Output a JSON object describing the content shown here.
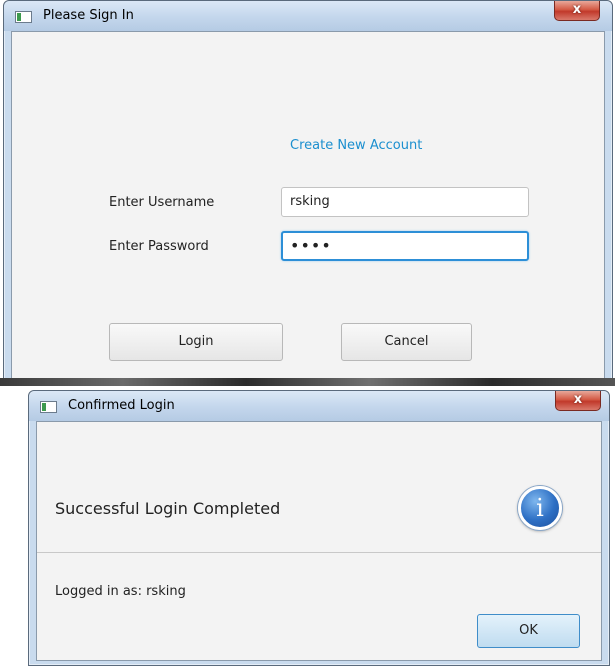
{
  "signin": {
    "title": "Please Sign In",
    "close_glyph": "x",
    "create_account_link": "Create New Account",
    "username_label": "Enter Username",
    "username_value": "rsking",
    "password_label": "Enter Password",
    "password_masked": "••••",
    "login_button": "Login",
    "cancel_button": "Cancel"
  },
  "confirm": {
    "title": "Confirmed Login",
    "close_glyph": "x",
    "message": "Successful Login Completed",
    "info_glyph": "i",
    "detail": "Logged in as: rsking",
    "ok_button": "OK"
  },
  "colors": {
    "link": "#1b8fcf",
    "focus_border": "#2d8fd7",
    "close_button": "#c1392b"
  }
}
